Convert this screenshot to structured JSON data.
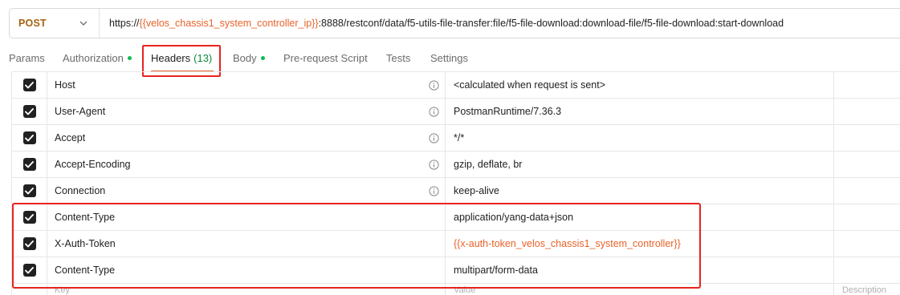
{
  "request": {
    "method": "POST",
    "url_prefix": "https://",
    "url_var": "{{velos_chassis1_system_controller_ip}}",
    "url_suffix": ":8888/restconf/data/f5-utils-file-transfer:file/f5-file-download:download-file/f5-file-download:start-download"
  },
  "tabs": {
    "params": "Params",
    "authorization": "Authorization",
    "headers": "Headers",
    "headers_count": "(13)",
    "body": "Body",
    "prerequest": "Pre-request Script",
    "tests": "Tests",
    "settings": "Settings"
  },
  "headers": [
    {
      "key": "Host",
      "value": "<calculated when request is sent>",
      "checked": true,
      "info": true
    },
    {
      "key": "User-Agent",
      "value": "PostmanRuntime/7.36.3",
      "checked": true,
      "info": true
    },
    {
      "key": "Accept",
      "value": "*/*",
      "checked": true,
      "info": true
    },
    {
      "key": "Accept-Encoding",
      "value": "gzip, deflate, br",
      "checked": true,
      "info": true
    },
    {
      "key": "Connection",
      "value": "keep-alive",
      "checked": true,
      "info": true
    },
    {
      "key": "Content-Type",
      "value": "application/yang-data+json",
      "checked": true,
      "info": false
    },
    {
      "key": "X-Auth-Token",
      "value": "{{x-auth-token_velos_chassis1_system_controller}}",
      "checked": true,
      "info": false,
      "is_variable": true
    },
    {
      "key": "Content-Type",
      "value": "multipart/form-data",
      "checked": true,
      "info": false
    }
  ],
  "placeholder": {
    "key": "Key",
    "value": "Value",
    "description": "Description"
  },
  "colors": {
    "accent": "#e8632a",
    "highlight": "#e8231f",
    "method": "#a6620f",
    "dot": "#0cbb52"
  }
}
